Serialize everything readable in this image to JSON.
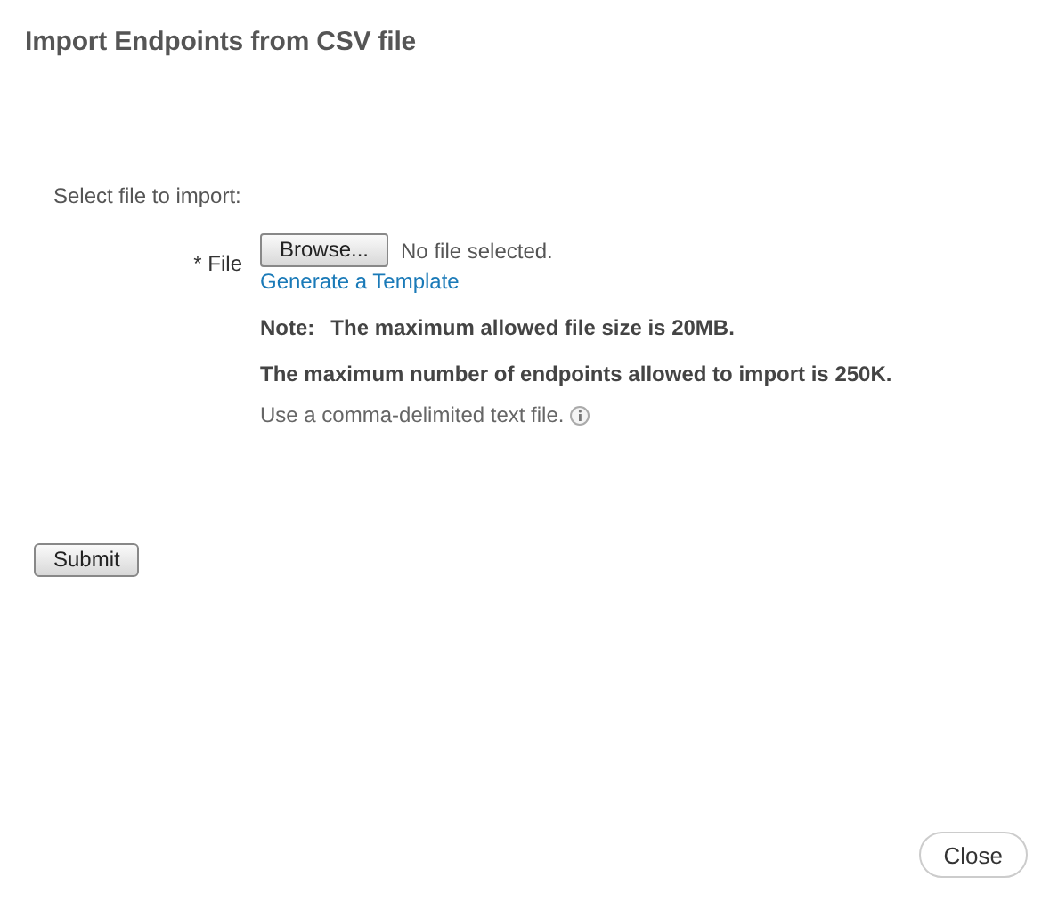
{
  "title": "Import Endpoints from CSV file",
  "section_label": "Select file to import:",
  "file_field": {
    "label": "* File",
    "button": "Browse...",
    "status": "No file selected."
  },
  "template_link": "Generate a Template",
  "note": {
    "label": "Note:",
    "text": "The maximum allowed file size is 20MB."
  },
  "limit_text": "The maximum number of endpoints allowed to import is 250K.",
  "hint": "Use a comma-delimited text file.",
  "buttons": {
    "submit": "Submit",
    "close": "Close"
  }
}
